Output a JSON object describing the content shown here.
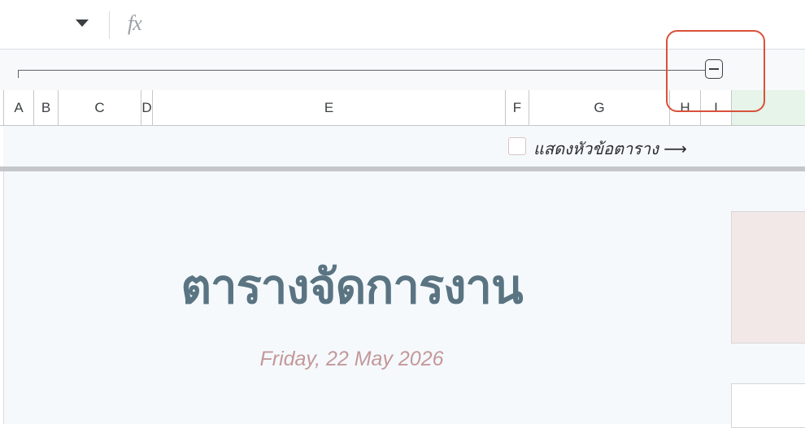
{
  "formula_bar": {
    "namebox_icon": "caret-down-icon",
    "fx_label": "fx"
  },
  "group_bar": {
    "collapse_icon": "minus-box-icon"
  },
  "columns": [
    {
      "label": "A"
    },
    {
      "label": "B"
    },
    {
      "label": "C"
    },
    {
      "label": "D"
    },
    {
      "label": "E"
    },
    {
      "label": "F"
    },
    {
      "label": "G"
    },
    {
      "label": "H"
    },
    {
      "label": "I"
    }
  ],
  "header_toggle": {
    "label": "แสดงหัวข้อตาราง ⟶",
    "checked": false
  },
  "sheet": {
    "title": "ตารางจัดการงาน",
    "date": "Friday, 22 May 2026"
  },
  "colors": {
    "highlight": "#d9513a",
    "title": "#5a7482",
    "date": "#c4989a",
    "selected_column": "#e6f4ea"
  }
}
